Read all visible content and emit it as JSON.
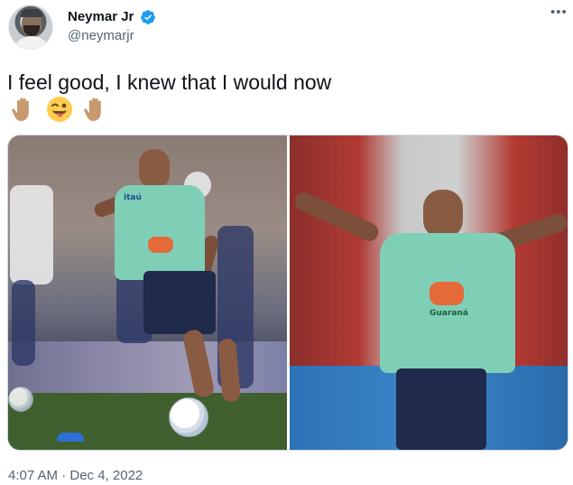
{
  "author": {
    "name": "Neymar Jr",
    "handle": "@neymarjr",
    "verified": true,
    "verified_color": "#1d9bf0"
  },
  "more_icon": "more-horizontal-icon",
  "tweet": {
    "text": "I feel good, I knew that I would now",
    "emojis": [
      "raised-hand-emoji",
      "winking-face-with-tongue-emoji",
      "raised-hand-emoji"
    ]
  },
  "media": {
    "photo_count": 2,
    "left_photo": {
      "shirt_text": "itaú",
      "sponsor_text": "Guaraná"
    },
    "right_photo": {
      "sponsor_text": "Guaraná"
    }
  },
  "timestamp": "4:07 AM · Dec 4, 2022",
  "colors": {
    "text": "#0f1419",
    "secondary_text": "#536471",
    "border": "#cfd9de",
    "jersey": "#7fcfb7"
  }
}
